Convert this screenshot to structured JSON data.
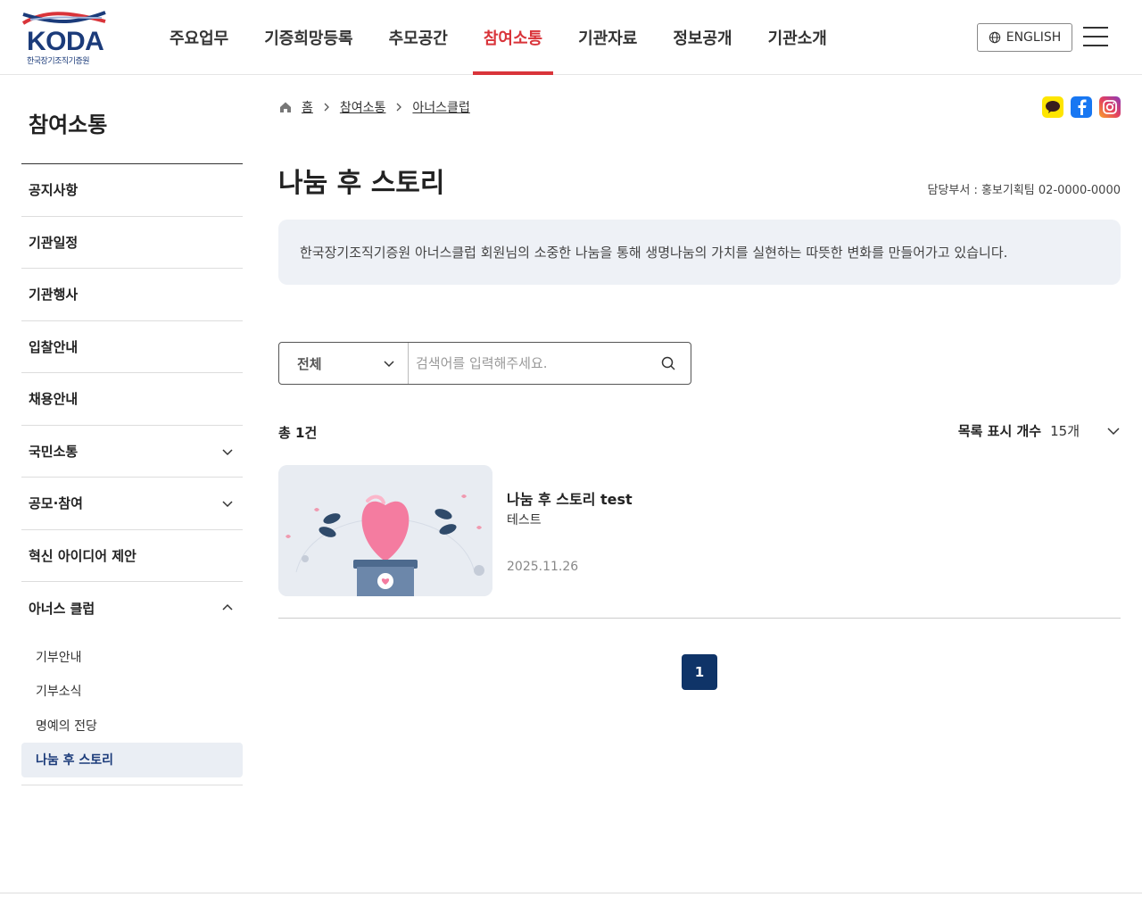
{
  "header": {
    "logo_text": "KODA",
    "logo_sub": "한국장기조직기증원",
    "nav": [
      {
        "label": "주요업무"
      },
      {
        "label": "기증희망등록"
      },
      {
        "label": "추모공간"
      },
      {
        "label": "참여소통"
      },
      {
        "label": "기관자료"
      },
      {
        "label": "정보공개"
      },
      {
        "label": "기관소개"
      }
    ],
    "english_label": "ENGLISH",
    "accent_color": "#d9343a",
    "brand_color": "#1b3b7a"
  },
  "sidebar": {
    "title": "참여소통",
    "items": [
      {
        "label": "공지사항"
      },
      {
        "label": "기관일정"
      },
      {
        "label": "기관행사"
      },
      {
        "label": "입찰안내"
      },
      {
        "label": "채용안내"
      },
      {
        "label": "국민소통"
      },
      {
        "label": "공모·참여"
      },
      {
        "label": "혁신 아이디어 제안"
      },
      {
        "label": "아너스 클럽"
      }
    ],
    "sub_items": [
      {
        "label": "기부안내"
      },
      {
        "label": "기부소식"
      },
      {
        "label": "명예의 전당"
      },
      {
        "label": "나눔 후 스토리"
      }
    ]
  },
  "breadcrumb": {
    "home": "홈",
    "level1": "참여소통",
    "level2": "아너스클럽"
  },
  "page": {
    "title": "나눔 후 스토리",
    "dept": "담당부서 : 홍보기획팀 02-0000-0000",
    "intro": "한국장기조직기증원 아너스클럽 회원님의 소중한 나눔을 통해 생명나눔의 가치를 실현하는 따뜻한 변화를 만들어가고 있습니다."
  },
  "search": {
    "category": "전체",
    "placeholder": "검색어를 입력해주세요."
  },
  "list": {
    "total": "총 1건",
    "per_page_label": "목록 표시 개수",
    "per_page_value": "15개",
    "items": [
      {
        "title": "나눔 후 스토리 test",
        "summary": "테스트",
        "date": "2025.11.26"
      }
    ]
  },
  "pagination": {
    "current": "1"
  }
}
